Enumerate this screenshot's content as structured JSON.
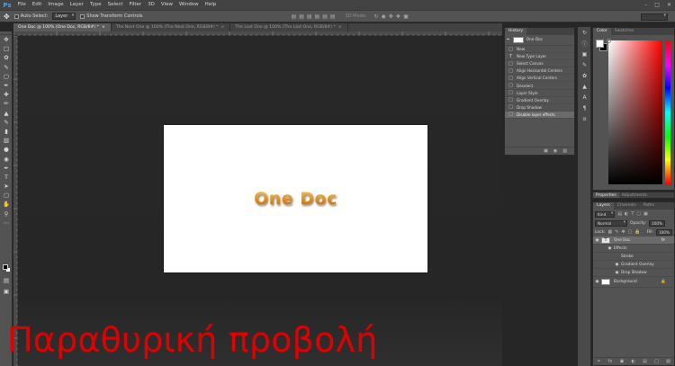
{
  "app": {
    "logo": "Ps"
  },
  "menu": [
    "File",
    "Edit",
    "Image",
    "Layer",
    "Type",
    "Select",
    "Filter",
    "3D",
    "View",
    "Window",
    "Help"
  ],
  "window_controls": {
    "minimize": "–",
    "maximize": "□",
    "close": "✕"
  },
  "options": {
    "auto_select_label": "Auto-Select:",
    "auto_select_value": "Layer",
    "transform_label": "Show Transform Controls",
    "mode_3d_label": "3D Mode:"
  },
  "tabs": [
    {
      "label": "One Doc @ 100% (One Doc, RGB/8#) *",
      "close": "×"
    },
    {
      "label": "The Next One @ 100% (The Next One, RGB/8#) *",
      "close": "×"
    },
    {
      "label": "The Last One @ 100% (The Last One, RGB/8#) *",
      "close": "×"
    }
  ],
  "document": {
    "text": "One Doc"
  },
  "caption": "Παραθυρική προβολή",
  "history": {
    "tab": "History",
    "snapshot": "One Doc",
    "items": [
      {
        "label": "New",
        "icon": "new-document-icon",
        "glyph": "□"
      },
      {
        "label": "New Type Layer",
        "icon": "type-icon",
        "glyph": "T"
      },
      {
        "label": "Select Canvas",
        "icon": "select-icon",
        "glyph": "□"
      },
      {
        "label": "Align Horizontal Centers",
        "icon": "align-icon",
        "glyph": "□"
      },
      {
        "label": "Align Vertical Centers",
        "icon": "align-icon",
        "glyph": "□"
      },
      {
        "label": "Deselect",
        "icon": "deselect-icon",
        "glyph": "□"
      },
      {
        "label": "Layer Style",
        "icon": "fx-icon",
        "glyph": "□"
      },
      {
        "label": "Gradient Overlay",
        "icon": "fx-icon",
        "glyph": "□"
      },
      {
        "label": "Drop Shadow",
        "icon": "fx-icon",
        "glyph": "□"
      },
      {
        "label": "Disable layer effects",
        "icon": "fx-icon",
        "glyph": "□"
      }
    ]
  },
  "color_panel": {
    "tabs": [
      "Color",
      "Swatches"
    ],
    "foreground": "#ffffff",
    "background": "#000000"
  },
  "properties_tabs": [
    "Properties",
    "Adjustments"
  ],
  "layers_panel": {
    "tabs": [
      "Layers",
      "Channels",
      "Paths"
    ],
    "filter_kind": "Kind",
    "blend_mode": "Normal",
    "opacity_label": "Opacity:",
    "opacity_value": "100%",
    "lock_label": "Lock:",
    "fill_label": "Fill:",
    "fill_value": "100%",
    "layers": [
      {
        "name": "One Doc",
        "type_glyph": "T",
        "fx": "fx"
      },
      {
        "name": "Effects"
      },
      {
        "name": "Stroke"
      },
      {
        "name": "Gradient Overlay"
      },
      {
        "name": "Drop Shadow"
      },
      {
        "name": "Background"
      }
    ]
  }
}
